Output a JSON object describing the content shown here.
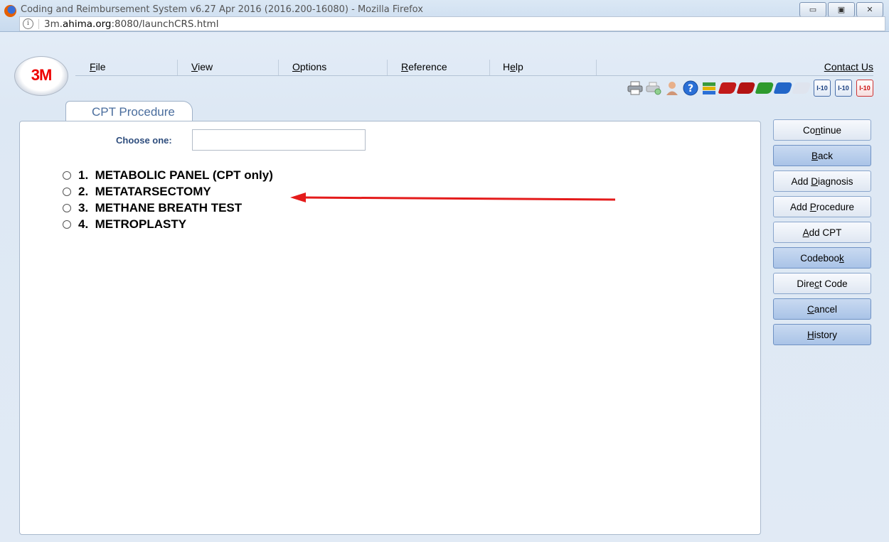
{
  "window": {
    "title": "Coding and Reimbursement System v6.27 Apr 2016 (2016.200-16080) - Mozilla Firefox",
    "controls": [
      "minimize",
      "maximize",
      "close"
    ]
  },
  "url": {
    "prefix": "3m.",
    "host": "ahima.org",
    "rest": ":8080/launchCRS.html"
  },
  "brand": {
    "logo_text": "3M"
  },
  "menu": {
    "items": [
      {
        "pre": "",
        "key": "F",
        "post": "ile"
      },
      {
        "pre": "",
        "key": "V",
        "post": "iew"
      },
      {
        "pre": "",
        "key": "O",
        "post": "ptions"
      },
      {
        "pre": "",
        "key": "R",
        "post": "eference"
      },
      {
        "pre": "H",
        "key": "e",
        "post": "lp"
      }
    ],
    "contact": "Contact Us"
  },
  "toolbar": {
    "icons": [
      "printer-icon",
      "print-preview-icon",
      "user-icon",
      "help-icon",
      "books-icon",
      "dx-book-icon",
      "icd10-book-icon",
      "green-book-icon",
      "blue-book-icon",
      "poa-icon"
    ],
    "i10_a": "I-10",
    "i10_b": "I-10",
    "i10_c": "I-10"
  },
  "tab": {
    "label": "CPT Procedure"
  },
  "form": {
    "choose_label": "Choose one:",
    "choose_value": ""
  },
  "options": [
    {
      "label": "1.  METABOLIC PANEL (CPT only)"
    },
    {
      "label": "2.  METATARSECTOMY"
    },
    {
      "label": "3.  METHANE BREATH TEST"
    },
    {
      "label": "4.  METROPLASTY"
    }
  ],
  "buttons": {
    "continue": {
      "pre": "Co",
      "key": "n",
      "post": "tinue"
    },
    "back": {
      "pre": "",
      "key": "B",
      "post": "ack"
    },
    "add_diagnosis": {
      "pre": "Add ",
      "key": "D",
      "post": "iagnosis"
    },
    "add_procedure": {
      "pre": "Add ",
      "key": "P",
      "post": "rocedure"
    },
    "add_cpt": {
      "pre": "",
      "key": "A",
      "post": "dd CPT"
    },
    "codebook": {
      "pre": "Codeboo",
      "key": "k",
      "post": ""
    },
    "direct_code": {
      "pre": "Dire",
      "key": "c",
      "post": "t Code"
    },
    "cancel": {
      "pre": "",
      "key": "C",
      "post": "ancel"
    },
    "history": {
      "pre": "",
      "key": "H",
      "post": "istory"
    }
  },
  "colors": {
    "annotation_arrow": "#e41b1b",
    "tab_text": "#4a6d9d",
    "label_text": "#2e4d7d",
    "logo_red": "#e00000"
  }
}
